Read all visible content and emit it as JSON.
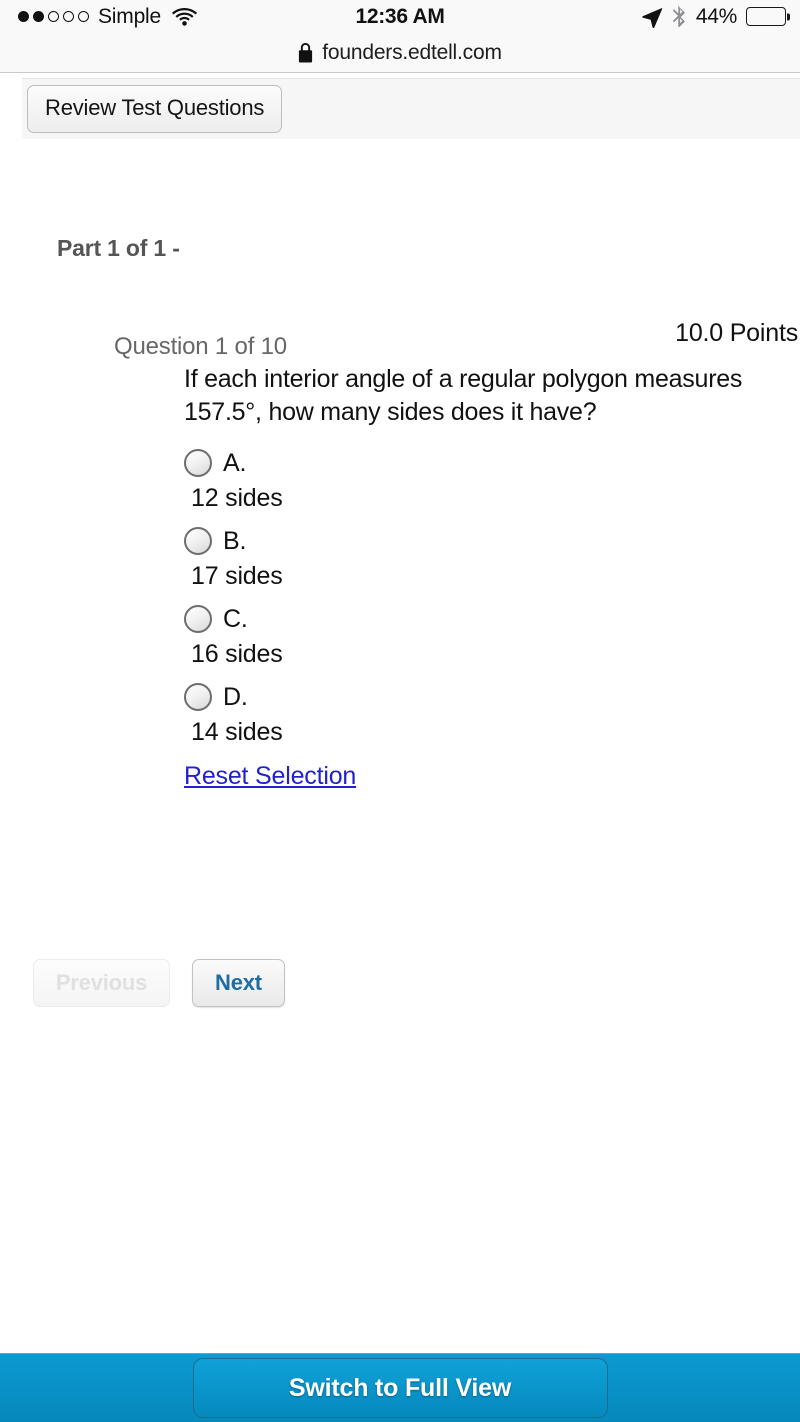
{
  "status_bar": {
    "signal_dots_total": 5,
    "signal_dots_filled": 2,
    "carrier": "Simple",
    "wifi_icon": "wifi-icon",
    "time": "12:36 AM",
    "location_icon": "location-arrow-icon",
    "bluetooth_icon": "bluetooth-icon",
    "battery_percent": "44%",
    "battery_level": 44,
    "battery_color": "#fcc207"
  },
  "browser": {
    "lock_icon": "lock-icon",
    "url": "founders.edtell.com"
  },
  "toolbar": {
    "review_label": "Review Test Questions"
  },
  "page": {
    "part_label": "Part 1 of 1 -"
  },
  "question": {
    "number_label": "Question 1 of 10",
    "points_label": "10.0 Points",
    "text": "If each interior angle of a regular polygon measures 157.5°, how many sides does it have?",
    "choices": [
      {
        "letter": "A.",
        "text": "12 sides",
        "selected": false
      },
      {
        "letter": "B.",
        "text": "17 sides",
        "selected": false
      },
      {
        "letter": "C.",
        "text": "16 sides",
        "selected": false
      },
      {
        "letter": "D.",
        "text": "14 sides",
        "selected": false
      }
    ],
    "reset_label": "Reset Selection",
    "reset_link_color": "#2222cc"
  },
  "nav": {
    "previous_label": "Previous",
    "previous_enabled": false,
    "next_label": "Next",
    "next_enabled": true,
    "next_color": "#1c6ea4"
  },
  "bottom_bar": {
    "switch_label": "Switch to Full View",
    "bar_color": "#0990c6"
  }
}
